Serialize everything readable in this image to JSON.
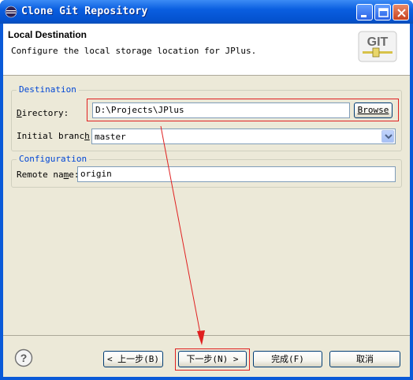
{
  "window": {
    "title": "Clone Git Repository"
  },
  "header": {
    "title": "Local Destination",
    "description": "Configure the local storage location for JPlus.",
    "logo_text": "GIT"
  },
  "destination": {
    "group_label": "Destination",
    "directory_label_pre": "D",
    "directory_label_post": "irectory:",
    "directory_value": "D:\\Projects\\JPlus",
    "browse_label": "Browse",
    "initial_branch_label_pre": "Initial branc",
    "initial_branch_label_ul": "h",
    "initial_branch_label_post": ":",
    "initial_branch_value": "master"
  },
  "configuration": {
    "group_label": "Configuration",
    "remote_name_label_pre": "Remote na",
    "remote_name_label_ul": "m",
    "remote_name_label_post": "e:",
    "remote_name_value": "origin"
  },
  "footer": {
    "back_label": "< 上一步(B)",
    "next_label": "下一步(N) >",
    "finish_label": "完成(F)",
    "cancel_label": "取消"
  },
  "colors": {
    "titlebar": "#0a5ee0",
    "dialog_bg": "#ece9d8",
    "group_label": "#0046d5",
    "annotation": "#e02020"
  },
  "icons": [
    "eclipse-icon",
    "minimize-icon",
    "maximize-icon",
    "close-icon",
    "git-logo-icon",
    "help-icon",
    "chevron-down-icon"
  ]
}
